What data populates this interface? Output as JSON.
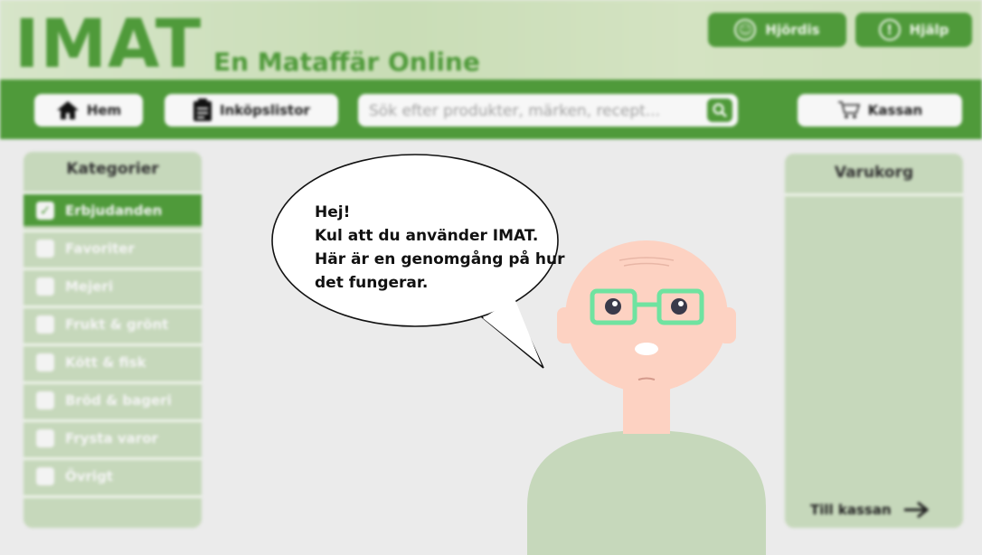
{
  "header": {
    "logo": "IMAT",
    "tagline": "En Mataffär Online",
    "user_button": "Hjördis",
    "help_button": "Hjälp"
  },
  "nav": {
    "home": "Hem",
    "lists": "Inköpslistor",
    "search_placeholder": "Sök efter produkter, märken, recept...",
    "checkout": "Kassan"
  },
  "categories": {
    "title": "Kategorier",
    "items": [
      {
        "label": "Erbjudanden",
        "checked": true
      },
      {
        "label": "Favoriter",
        "checked": false
      },
      {
        "label": "Mejeri",
        "checked": false
      },
      {
        "label": "Frukt & grönt",
        "checked": false
      },
      {
        "label": "Kött & fisk",
        "checked": false
      },
      {
        "label": "Bröd & bageri",
        "checked": false
      },
      {
        "label": "Frysta varor",
        "checked": false
      },
      {
        "label": "Övrigt",
        "checked": false
      }
    ]
  },
  "cart": {
    "title": "Varukorg",
    "checkout_link": "Till kassan"
  },
  "guide": {
    "line1": "Hej!",
    "line2": "Kul att du använder IMAT.",
    "line3": "Här är en genomgång på hur",
    "line4": "det fungerar."
  },
  "colors": {
    "brand_green": "#4f9a3a",
    "panel_green": "#c6d8bb",
    "glasses_green": "#6fe3a0",
    "skin": "#fdd2c2",
    "shirt": "#c6d8bb"
  }
}
